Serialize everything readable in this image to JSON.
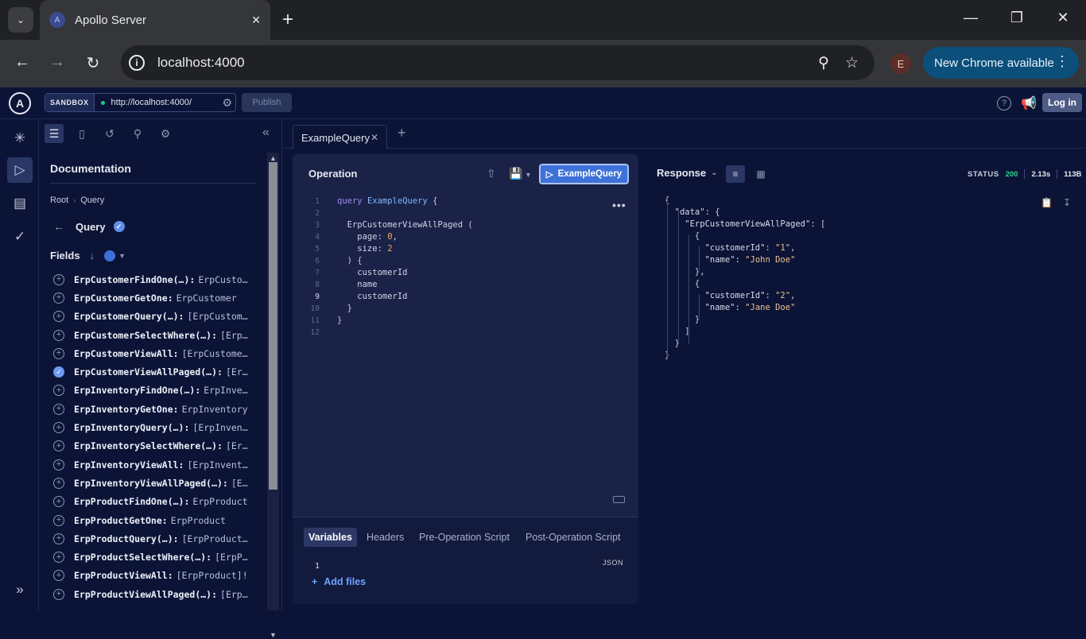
{
  "browser": {
    "tab_title": "Apollo Server",
    "url": "localhost:4000",
    "profile_initial": "E",
    "update_label": "New Chrome available"
  },
  "header": {
    "sandbox_label": "SANDBOX",
    "endpoint": "http://localhost:4000/",
    "publish_label": "Publish",
    "login_label": "Log in"
  },
  "docs": {
    "title": "Documentation",
    "breadcrumb": [
      "Root",
      "Query"
    ],
    "current_type": "Query",
    "fields_label": "Fields",
    "fields": [
      {
        "name": "ErpCustomerFindOne(…):",
        "type": "ErpCusto…",
        "selected": false
      },
      {
        "name": "ErpCustomerGetOne:",
        "type": "ErpCustomer",
        "selected": false
      },
      {
        "name": "ErpCustomerQuery(…):",
        "type": "[ErpCustom…",
        "selected": false
      },
      {
        "name": "ErpCustomerSelectWhere(…):",
        "type": "[Erp…",
        "selected": false
      },
      {
        "name": "ErpCustomerViewAll:",
        "type": "[ErpCustome…",
        "selected": false
      },
      {
        "name": "ErpCustomerViewAllPaged(…):",
        "type": "[Er…",
        "selected": true
      },
      {
        "name": "ErpInventoryFindOne(…):",
        "type": "ErpInve…",
        "selected": false
      },
      {
        "name": "ErpInventoryGetOne:",
        "type": "ErpInventory",
        "selected": false
      },
      {
        "name": "ErpInventoryQuery(…):",
        "type": "[ErpInven…",
        "selected": false
      },
      {
        "name": "ErpInventorySelectWhere(…):",
        "type": "[Er…",
        "selected": false
      },
      {
        "name": "ErpInventoryViewAll:",
        "type": "[ErpInvent…",
        "selected": false
      },
      {
        "name": "ErpInventoryViewAllPaged(…):",
        "type": "[E…",
        "selected": false
      },
      {
        "name": "ErpProductFindOne(…):",
        "type": "ErpProduct",
        "selected": false
      },
      {
        "name": "ErpProductGetOne:",
        "type": "ErpProduct",
        "selected": false
      },
      {
        "name": "ErpProductQuery(…):",
        "type": "[ErpProduct…",
        "selected": false
      },
      {
        "name": "ErpProductSelectWhere(…):",
        "type": "[ErpP…",
        "selected": false
      },
      {
        "name": "ErpProductViewAll:",
        "type": "[ErpProduct]!",
        "selected": false
      },
      {
        "name": "ErpProductViewAllPaged(…):",
        "type": "[Erp…",
        "selected": false
      }
    ]
  },
  "operation": {
    "tab_label": "ExampleQuery",
    "title": "Operation",
    "run_label": "ExampleQuery",
    "code": [
      {
        "n": "1",
        "parts": [
          [
            "kw",
            "query "
          ],
          [
            "op-name",
            "ExampleQuery"
          ],
          [
            "pun",
            " {"
          ]
        ]
      },
      {
        "n": "2",
        "parts": []
      },
      {
        "n": "3",
        "parts": [
          [
            "fld",
            "  ErpCustomerViewAllPaged"
          ],
          [
            "pun",
            " ("
          ]
        ]
      },
      {
        "n": "4",
        "parts": [
          [
            "fld",
            "    page"
          ],
          [
            "pun",
            ": "
          ],
          [
            "num",
            "0"
          ],
          [
            "pun",
            ","
          ]
        ]
      },
      {
        "n": "5",
        "parts": [
          [
            "fld",
            "    size"
          ],
          [
            "pun",
            ": "
          ],
          [
            "num",
            "2"
          ]
        ]
      },
      {
        "n": "6",
        "parts": [
          [
            "pun",
            "  ) {"
          ]
        ]
      },
      {
        "n": "7",
        "parts": [
          [
            "fld",
            "    customerId"
          ]
        ]
      },
      {
        "n": "8",
        "parts": [
          [
            "fld",
            "    name"
          ]
        ]
      },
      {
        "n": "9",
        "parts": [
          [
            "fld",
            "    customerId"
          ]
        ]
      },
      {
        "n": "10",
        "parts": [
          [
            "pun",
            "  }"
          ]
        ]
      },
      {
        "n": "11",
        "parts": [
          [
            "pun",
            "}"
          ]
        ]
      },
      {
        "n": "12",
        "parts": []
      }
    ],
    "current_line": "9",
    "bottom_tabs": [
      "Variables",
      "Headers",
      "Pre-Operation Script",
      "Post-Operation Script"
    ],
    "json_label": "JSON",
    "variables_line": "1",
    "add_files_label": "Add files"
  },
  "response": {
    "title": "Response",
    "status_label": "STATUS",
    "status_code": "200",
    "time": "2.13s",
    "size": "113B",
    "lines": [
      [
        [
          "pun",
          "{"
        ]
      ],
      [
        [
          "r-key",
          "  \"data\""
        ],
        [
          "pun",
          ": {"
        ]
      ],
      [
        [
          "r-key",
          "    \"ErpCustomerViewAllPaged\""
        ],
        [
          "pun",
          ": ["
        ]
      ],
      [
        [
          "pun",
          "      {"
        ]
      ],
      [
        [
          "r-key",
          "        \"customerId\""
        ],
        [
          "pun",
          ": "
        ],
        [
          "r-str",
          "\"1\""
        ],
        [
          "pun",
          ","
        ]
      ],
      [
        [
          "r-key",
          "        \"name\""
        ],
        [
          "pun",
          ": "
        ],
        [
          "r-str",
          "\"John Doe\""
        ]
      ],
      [
        [
          "pun",
          "      },"
        ]
      ],
      [
        [
          "pun",
          "      {"
        ]
      ],
      [
        [
          "r-key",
          "        \"customerId\""
        ],
        [
          "pun",
          ": "
        ],
        [
          "r-str",
          "\"2\""
        ],
        [
          "pun",
          ","
        ]
      ],
      [
        [
          "r-key",
          "        \"name\""
        ],
        [
          "pun",
          ": "
        ],
        [
          "r-str",
          "\"Jane Doe\""
        ]
      ],
      [
        [
          "pun",
          "      }"
        ]
      ],
      [
        [
          "pun",
          "    ]"
        ]
      ],
      [
        [
          "pun",
          "  }"
        ]
      ],
      [
        [
          "pun",
          "}"
        ]
      ]
    ]
  },
  "icons": {
    "run": "play-icon",
    "back": "arrow-left-icon"
  }
}
